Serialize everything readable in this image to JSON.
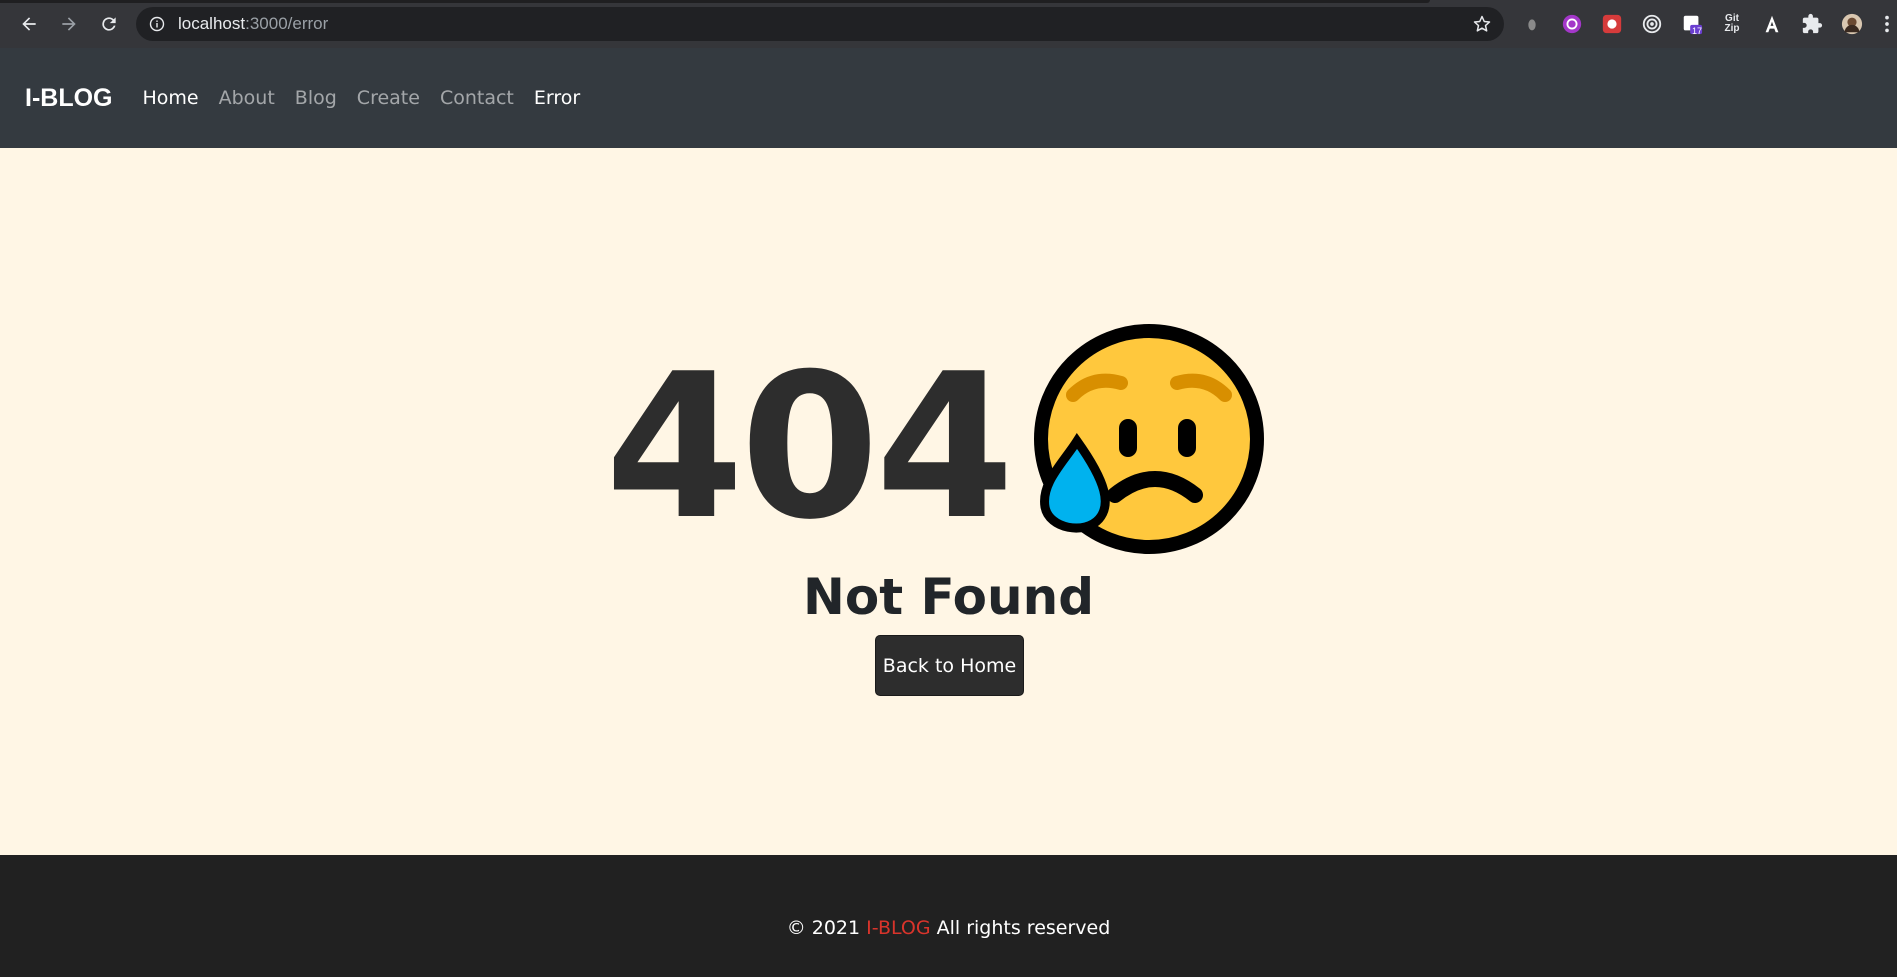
{
  "browser": {
    "url_host": "localhost",
    "url_path": ":3000/error",
    "extensions": [
      "mouse-extension-icon",
      "purple-extension-icon",
      "red-extension-icon",
      "target-extension-icon",
      "calendar-extension-icon",
      "gitzip-extension-icon",
      "angular-extension-icon",
      "puzzle-icon",
      "profile-avatar"
    ],
    "calendar_badge": "17",
    "gitzip_label_top": "Git",
    "gitzip_label_bottom": "Zip"
  },
  "navbar": {
    "brand": "I-BLOG",
    "links": [
      "Home",
      "About",
      "Blog",
      "Create",
      "Contact",
      "Error"
    ],
    "active_links": [
      "Home",
      "Error"
    ]
  },
  "error": {
    "code": "404",
    "message": "Not Found",
    "button_label": "Back to Home",
    "emoji": "sad-but-relieved-face"
  },
  "footer": {
    "prefix": "© 2021",
    "brand": "I-BLOG",
    "suffix": "All rights reserved",
    "brand_color": "#d9342b"
  },
  "colors": {
    "navbar_bg": "#343a40",
    "page_bg": "#fff6e5",
    "footer_bg": "#212121",
    "button_bg": "#2d2d2d"
  }
}
